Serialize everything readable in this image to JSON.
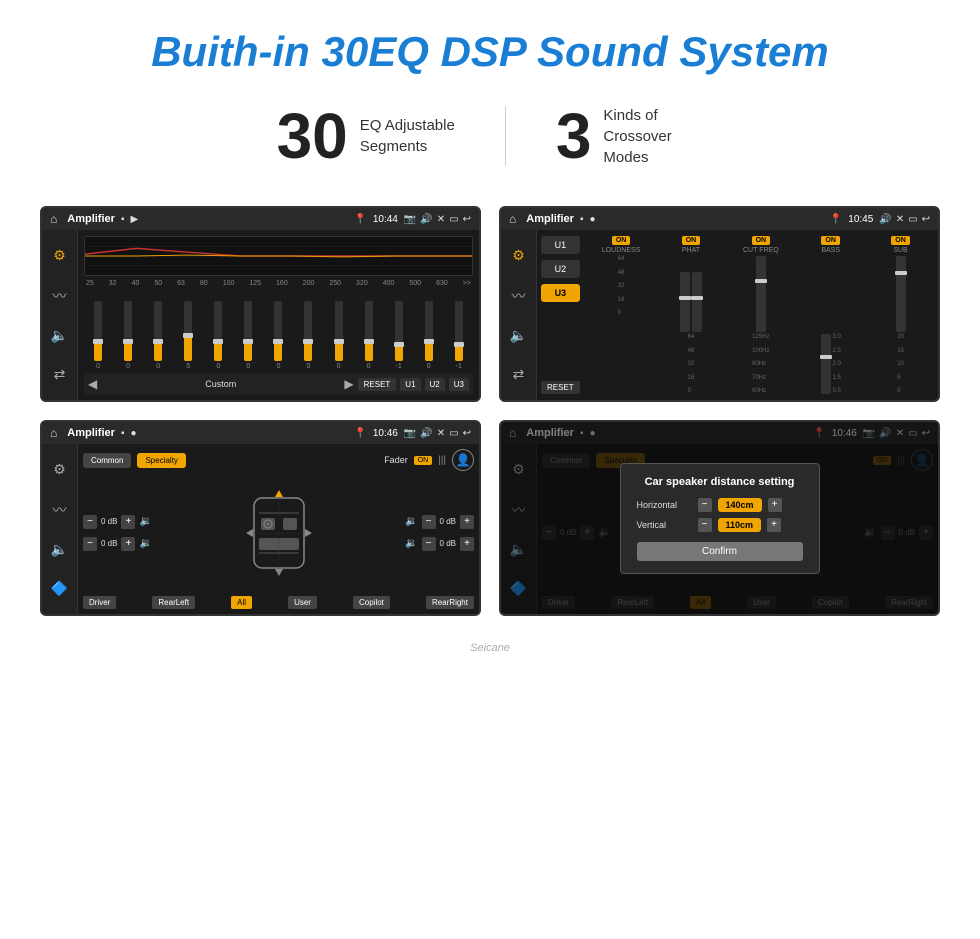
{
  "page": {
    "title": "Buith-in 30EQ DSP Sound System",
    "stat1_number": "30",
    "stat1_label": "EQ Adjustable\nSegments",
    "stat2_number": "3",
    "stat2_label": "Kinds of\nCrossover Modes"
  },
  "screens": {
    "screen1": {
      "title": "Amplifier",
      "time": "10:44",
      "eq_freqs": [
        "25",
        "32",
        "40",
        "50",
        "63",
        "80",
        "100",
        "125",
        "160",
        "200",
        "250",
        "320",
        "400",
        "500",
        "630"
      ],
      "eq_values": [
        "0",
        "0",
        "0",
        "0",
        "5",
        "0",
        "0",
        "0",
        "0",
        "0",
        "0",
        "0",
        "-1",
        "0",
        "-1"
      ],
      "preset_label": "Custom",
      "buttons": [
        "RESET",
        "U1",
        "U2",
        "U3"
      ]
    },
    "screen2": {
      "title": "Amplifier",
      "time": "10:45",
      "presets": [
        "U1",
        "U2",
        "U3"
      ],
      "active_preset": "U3",
      "channels": [
        "LOUDNESS",
        "PHAT",
        "CUT FREQ",
        "BASS",
        "SUB"
      ],
      "reset_label": "RESET"
    },
    "screen3": {
      "title": "Amplifier",
      "time": "10:46",
      "common_label": "Common",
      "specialty_label": "Specialty",
      "fader_label": "Fader",
      "fader_on": "ON",
      "db_values": [
        "0 dB",
        "0 dB",
        "0 dB",
        "0 dB"
      ],
      "position_labels": [
        "Driver",
        "RearLeft",
        "Copilot",
        "RearRight"
      ],
      "all_label": "All",
      "user_label": "User"
    },
    "screen4": {
      "title": "Amplifier",
      "time": "10:46",
      "common_label": "Common",
      "specialty_label": "Specialty",
      "dialog": {
        "title": "Car speaker distance setting",
        "horizontal_label": "Horizontal",
        "horizontal_value": "140cm",
        "vertical_label": "Vertical",
        "vertical_value": "110cm",
        "confirm_label": "Confirm"
      },
      "db_values": [
        "0 dB",
        "0 dB"
      ],
      "position_labels": [
        "Driver",
        "RearLeft",
        "Copilot",
        "RearRight"
      ]
    }
  },
  "watermark": "Seicane"
}
